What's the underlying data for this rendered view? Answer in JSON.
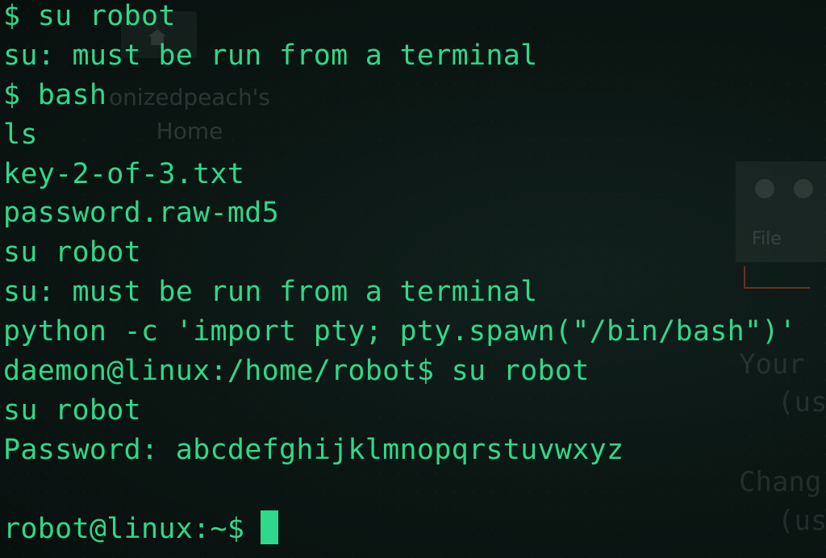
{
  "background": {
    "home_label_line1": "onizedpeach's",
    "home_label_line2": "Home",
    "window_menu_file": "File",
    "side_text": [
      "Your",
      "(us",
      "Chang",
      "(us"
    ]
  },
  "terminal": {
    "text_color": "#2fd98a",
    "background_color": "#0b1412",
    "lines": [
      "$ su robot",
      "su: must be run from a terminal",
      "$ bash",
      "ls",
      "key-2-of-3.txt",
      "password.raw-md5",
      "su robot",
      "su: must be run from a terminal",
      "python -c 'import pty; pty.spawn(\"/bin/bash\")'",
      "daemon@linux:/home/robot$ su robot",
      "su robot",
      "Password: abcdefghijklmnopqrstuvwxyz",
      "",
      "robot@linux:~$"
    ]
  }
}
